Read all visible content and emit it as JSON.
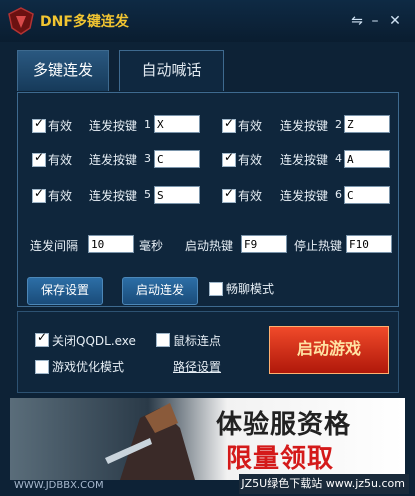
{
  "window": {
    "title": "DNF多键连发",
    "icons": [
      "menu-icon",
      "minimize-icon",
      "close-icon"
    ]
  },
  "tabs": [
    {
      "label": "多键连发",
      "active": true
    },
    {
      "label": "自动喊话",
      "active": false
    }
  ],
  "keys": [
    {
      "enabled_label": "有效",
      "label": "连发按键",
      "index": "1",
      "value": "X",
      "checked": true
    },
    {
      "enabled_label": "有效",
      "label": "连发按键",
      "index": "2",
      "value": "Z",
      "checked": true
    },
    {
      "enabled_label": "有效",
      "label": "连发按键",
      "index": "3",
      "value": "C",
      "checked": true
    },
    {
      "enabled_label": "有效",
      "label": "连发按键",
      "index": "4",
      "value": "A",
      "checked": true
    },
    {
      "enabled_label": "有效",
      "label": "连发按键",
      "index": "5",
      "value": "S",
      "checked": true
    },
    {
      "enabled_label": "有效",
      "label": "连发按键",
      "index": "6",
      "value": "C",
      "checked": true
    }
  ],
  "settings": {
    "interval_label": "连发间隔",
    "interval_value": "10",
    "interval_unit": "毫秒",
    "start_hotkey_label": "启动热键",
    "start_hotkey_value": "F9",
    "stop_hotkey_label": "停止热键",
    "stop_hotkey_value": "F10"
  },
  "buttons": {
    "save": "保存设置",
    "start_repeat": "启动连发",
    "chat_mode": "畅聊模式"
  },
  "lower": {
    "close_qqdl": "关闭QQDL.exe",
    "close_qqdl_checked": true,
    "mouse_repeat": "鼠标连点",
    "mouse_repeat_checked": false,
    "optimize": "游戏优化模式",
    "optimize_checked": false,
    "path": "路径设置",
    "start_game": "启动游戏"
  },
  "banner": {
    "line1": "体验服资格",
    "line2": "限量领取"
  },
  "footer": {
    "left": "WWW.JDBBX.COM",
    "right": "JZ5U绿色下载站 www.jz5u.com"
  }
}
